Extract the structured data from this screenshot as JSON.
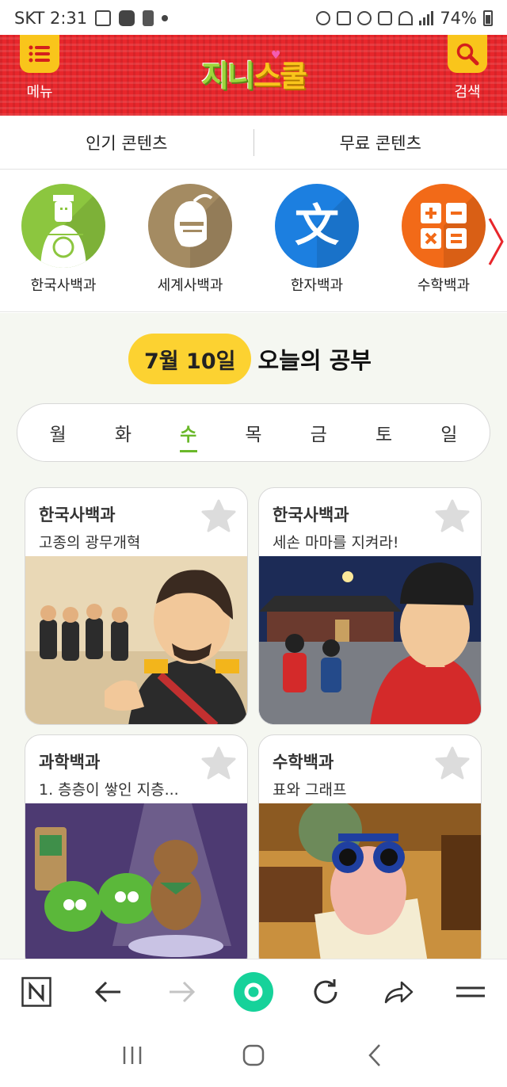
{
  "status_bar": {
    "carrier_time": "SKT 2:31",
    "battery": "74%"
  },
  "header": {
    "menu_label": "메뉴",
    "search_label": "검색",
    "logo_text_a": "지니",
    "logo_text_b": "스쿨"
  },
  "content_tabs": [
    {
      "label": "인기 콘텐츠"
    },
    {
      "label": "무료 콘텐츠"
    }
  ],
  "categories": [
    {
      "label": "한국사백과",
      "icon": "warrior-icon",
      "color": "#8cc63f"
    },
    {
      "label": "세계사백과",
      "icon": "knight-helmet-icon",
      "color": "#a48b62"
    },
    {
      "label": "한자백과",
      "icon": "hanja-icon",
      "color": "#1c7fe0"
    },
    {
      "label": "수학백과",
      "icon": "math-icon",
      "color": "#f26a18"
    }
  ],
  "today": {
    "date": "7월 10일",
    "label": "오늘의 공부",
    "days": [
      "월",
      "화",
      "수",
      "목",
      "금",
      "토",
      "일"
    ],
    "active_day": "수"
  },
  "cards": [
    {
      "category": "한국사백과",
      "title": "고종의 광무개혁"
    },
    {
      "category": "한국사백과",
      "title": "세손 마마를 지켜라!"
    },
    {
      "category": "과학백과",
      "title": "1. 층층이 쌓인 지층..."
    },
    {
      "category": "수학백과",
      "title": "표와 그래프"
    }
  ],
  "colors": {
    "header_red": "#e8262b",
    "accent_yellow": "#fcd231",
    "active_green": "#6ab82a"
  }
}
